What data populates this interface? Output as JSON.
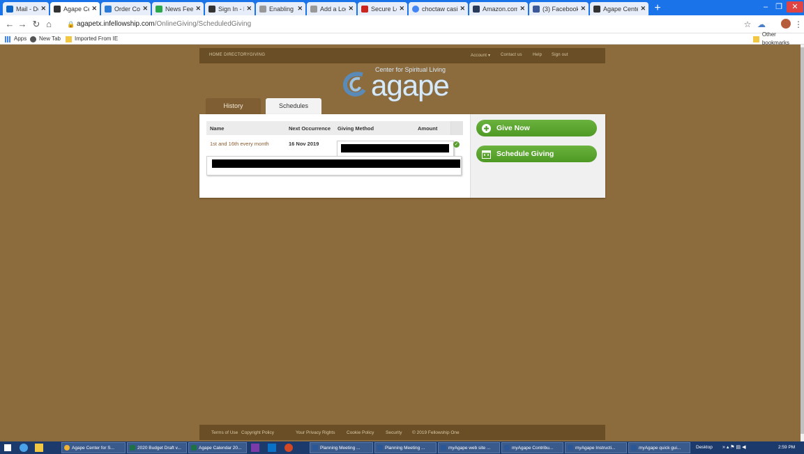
{
  "browser": {
    "tabs": [
      {
        "title": "Mail - Deb Lit",
        "favcolor": "#0a64c8"
      },
      {
        "title": "Agape Center",
        "favcolor": "#333333",
        "active": true
      },
      {
        "title": "Order Confirm",
        "favcolor": "#2b7bd6"
      },
      {
        "title": "News Feed —",
        "favcolor": "#2aa84a"
      },
      {
        "title": "Sign In - Fello",
        "favcolor": "#333333"
      },
      {
        "title": "Enabling Onlin",
        "favcolor": "#999999"
      },
      {
        "title": "Add a Logo to",
        "favcolor": "#999999"
      },
      {
        "title": "Secure Log Of",
        "favcolor": "#c8261e"
      },
      {
        "title": "choctaw casin",
        "favcolor": "#4285f4"
      },
      {
        "title": "Amazon.com",
        "favcolor": "#2a3a5a"
      },
      {
        "title": "(3) Facebook",
        "favcolor": "#3b5998"
      },
      {
        "title": "Agape Center",
        "favcolor": "#333333"
      }
    ],
    "url_domain": "agapetx.infellowship.com",
    "url_path": "/OnlineGiving/ScheduledGiving",
    "bookmarks": {
      "apps": "Apps",
      "new_tab": "New Tab",
      "imported": "Imported From IE",
      "other": "Other bookmarks"
    }
  },
  "site": {
    "nav_left": [
      "HOME",
      "DIRECTORY",
      "GIVING"
    ],
    "nav_right": [
      "Account ▾",
      "Contact us",
      "Help",
      "Sign out"
    ],
    "logo": {
      "tagline": "Center for Spiritual Living",
      "word": "agape"
    },
    "tabs": {
      "history": "History",
      "schedules": "Schedules"
    },
    "table": {
      "headers": [
        "Name",
        "Next Occurrence",
        "Giving Method",
        "Amount"
      ],
      "row": {
        "name": "1st and 16th every month",
        "next": "16 Nov 2019"
      }
    },
    "actions": {
      "give_now": "Give Now",
      "schedule_giving": "Schedule Giving"
    },
    "footer": [
      "Terms of Use",
      "Copyright Policy",
      "Your Privacy Rights",
      "Cookie Policy",
      "Security",
      "© 2019 Fellowship One"
    ],
    "colors": {
      "green": "#5aa52f",
      "brown_bar": "#6a4e26",
      "link": "#8a5a2c"
    }
  },
  "taskbar": {
    "items": [
      {
        "label": "Agape Center for S...",
        "color": "#f2b233"
      },
      {
        "label": "2020 Budget Draft v...",
        "color": "#1e7145"
      },
      {
        "label": "Agape Calendar 20...",
        "color": "#1e7145"
      },
      {
        "label": "Planning Meeting ...",
        "color": "#2b5797"
      },
      {
        "label": "Planning Meeting ...",
        "color": "#2b5797"
      },
      {
        "label": "myAgape web site ...",
        "color": "#2b5797"
      },
      {
        "label": "myAgape Contribu...",
        "color": "#2b5797"
      },
      {
        "label": "myAgape Instructi...",
        "color": "#2b5797"
      },
      {
        "label": "myAgape quick gui...",
        "color": "#2b5797"
      }
    ],
    "desktop": "Desktop",
    "time": "2:59 PM"
  }
}
